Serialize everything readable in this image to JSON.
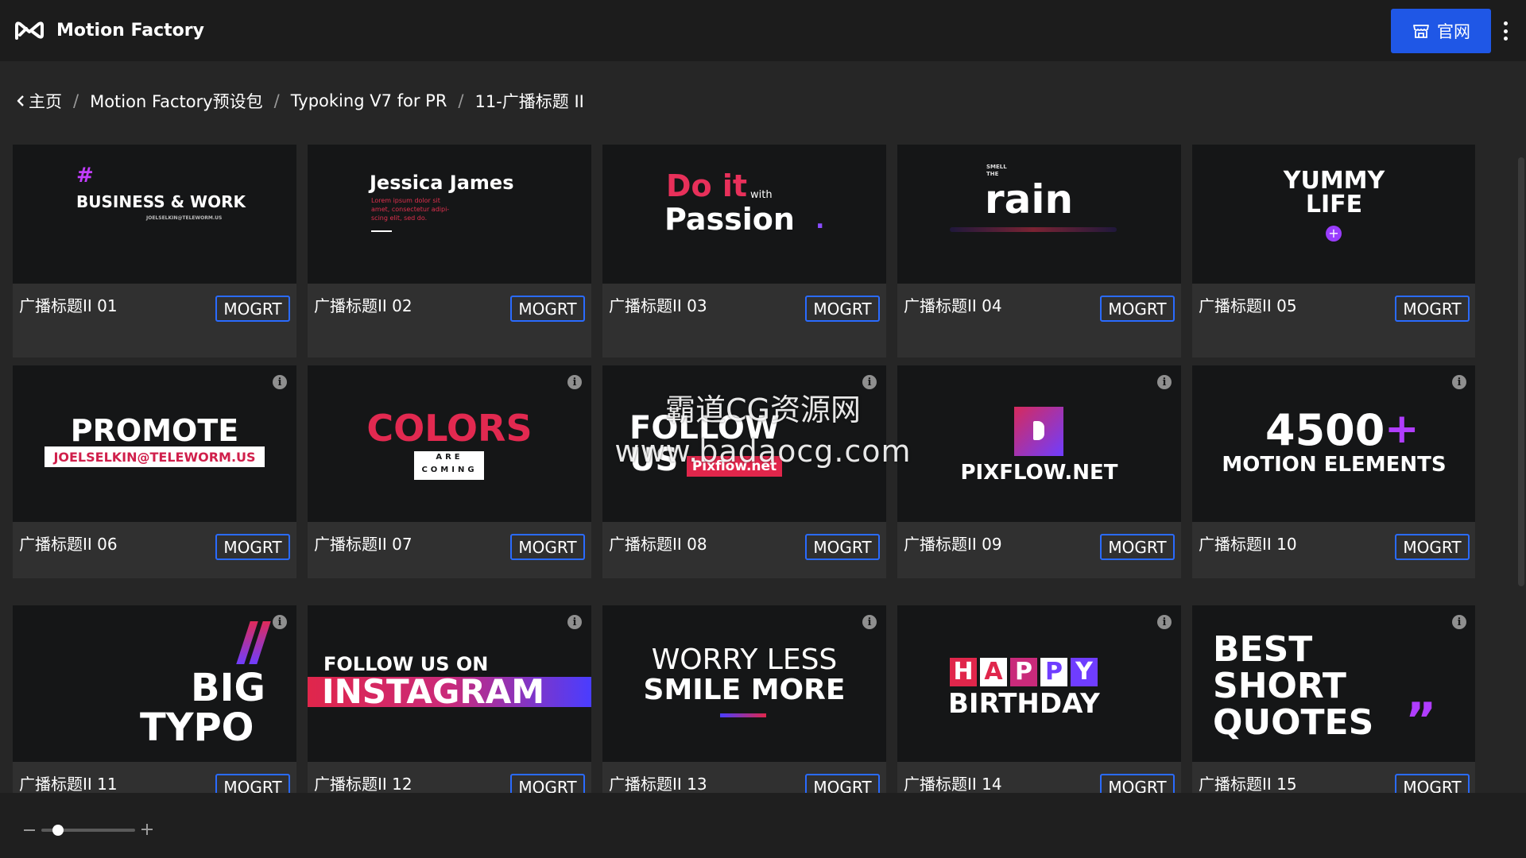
{
  "header": {
    "app_title": "Motion Factory",
    "site_button_label": "官网",
    "accent_color": "#1f57e6"
  },
  "breadcrumb": {
    "items": [
      "主页",
      "Motion Factory预设包",
      "Typoking V7 for PR",
      "11-广播标题 II"
    ],
    "separator": "/"
  },
  "grid": {
    "items": [
      {
        "title": "广播标题II 01",
        "button": "MOGRT",
        "preview": [
          "#",
          "BUSINESS & WORK",
          "JOELSELKIN@TELEWORM.US"
        ]
      },
      {
        "title": "广播标题II 02",
        "button": "MOGRT",
        "preview": [
          "Jessica James",
          "Lorem ipsum dolor sit",
          "amet, consectetur adipi-",
          "scing elit, sed do."
        ]
      },
      {
        "title": "广播标题II 03",
        "button": "MOGRT",
        "preview": [
          "Do it",
          "with",
          "Passion",
          "."
        ]
      },
      {
        "title": "广播标题II 04",
        "button": "MOGRT",
        "preview": [
          "SMELL",
          "THE",
          "rain"
        ]
      },
      {
        "title": "广播标题II 05",
        "button": "MOGRT",
        "preview": [
          "YUMMY",
          "LIFE"
        ]
      },
      {
        "title": "广播标题II 06",
        "button": "MOGRT",
        "preview": [
          "PROMOTE",
          "JOELSELKIN@TELEWORM.US"
        ]
      },
      {
        "title": "广播标题II 07",
        "button": "MOGRT",
        "preview": [
          "COLORS",
          "ARE",
          "COMING"
        ]
      },
      {
        "title": "广播标题II 08",
        "button": "MOGRT",
        "preview": [
          "FOLLOW",
          "US",
          "Pixflow.net"
        ]
      },
      {
        "title": "广播标题II 09",
        "button": "MOGRT",
        "preview": [
          "PIXFLOW.NET"
        ]
      },
      {
        "title": "广播标题II 10",
        "button": "MOGRT",
        "preview": [
          "4500",
          "+",
          "MOTION ELEMENTS"
        ]
      },
      {
        "title": "广播标题II 11",
        "button": "MOGRT",
        "preview": [
          "BIG",
          "TYPO"
        ]
      },
      {
        "title": "广播标题II 12",
        "button": "MOGRT",
        "preview": [
          "FOLLOW US ON",
          "INSTAGRAM"
        ]
      },
      {
        "title": "广播标题II 13",
        "button": "MOGRT",
        "preview": [
          "WORRY LESS",
          "SMILE MORE"
        ]
      },
      {
        "title": "广播标题II 14",
        "button": "MOGRT",
        "preview": [
          "H",
          "A",
          "P",
          "P",
          "Y",
          "BIRTHDAY"
        ]
      },
      {
        "title": "广播标题II 15",
        "button": "MOGRT",
        "preview": [
          "BEST",
          "SHORT",
          "QUOTES",
          "”"
        ]
      }
    ]
  },
  "watermark": {
    "line1": "霸道CG资源网",
    "line2": "www.badaocg.com"
  },
  "zoom": {
    "level": 0.18
  },
  "icons": {
    "logo": "motion-factory-logo-icon",
    "site": "storefront-icon",
    "menu": "more-vertical-icon",
    "back": "chevron-left-icon",
    "info": "info-icon",
    "zoom_out": "minus-icon",
    "zoom_in": "plus-icon"
  }
}
